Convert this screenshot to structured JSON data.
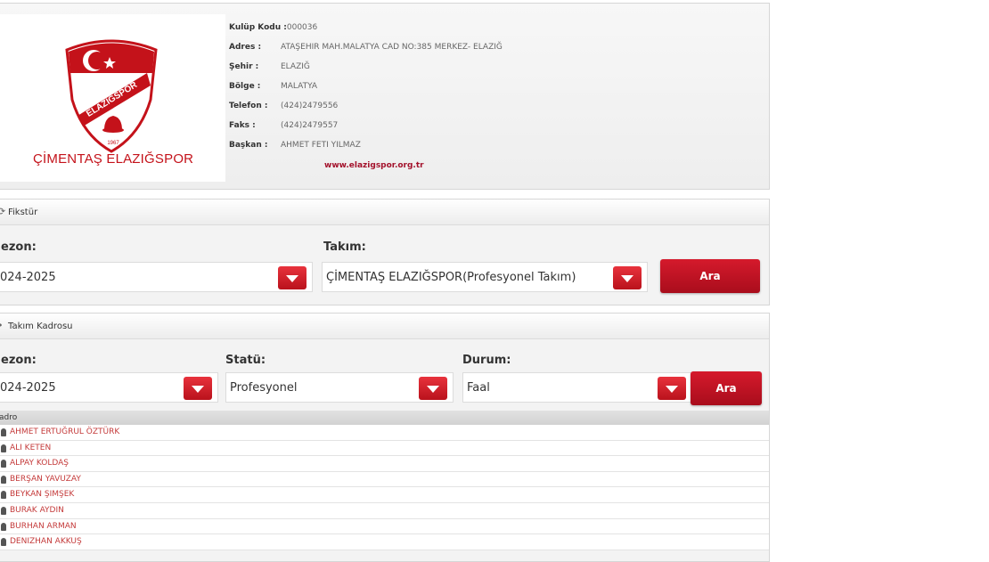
{
  "club": {
    "logo_text": "ELAZIĞSPOR",
    "logo_year": "1967",
    "name": "ÇİMENTAŞ ELAZIĞSPOR",
    "code_label": "Kulüp Kodu :",
    "code_value": "000036",
    "fields": [
      {
        "label": "Adres :",
        "value": "ATAŞEHIR MAH.MALATYA CAD NO:385 MERKEZ- ELAZIĞ"
      },
      {
        "label": "Şehir :",
        "value": "ELAZIĞ"
      },
      {
        "label": "Bölge :",
        "value": "MALATYA"
      },
      {
        "label": "Telefon :",
        "value": "(424)2479556"
      },
      {
        "label": "Faks :",
        "value": "(424)2479557"
      },
      {
        "label": "Başkan :",
        "value": "AHMET FETI YILMAZ"
      }
    ],
    "website": "www.elazigspor.org.tr"
  },
  "fikstur": {
    "title": "Fikstür",
    "sezon_label": "ezon:",
    "sezon_value": "024-2025",
    "takim_label": "Takım:",
    "takim_value": "ÇİMENTAŞ ELAZIĞSPOR(Profesyonel Takım)",
    "button": "Ara"
  },
  "kadro": {
    "title": "Takım Kadrosu",
    "sezon_label": "ezon:",
    "sezon_value": "024-2025",
    "statu_label": "Statü:",
    "statu_value": "Profesyonel",
    "durum_label": "Durum:",
    "durum_value": "Faal",
    "button": "Ara",
    "table_header": "adro",
    "players": [
      "AHMET ERTUĞRUL ÖZTÜRK",
      "ALI KETEN",
      "ALPAY KOLDAŞ",
      "BERŞAN YAVUZAY",
      "BEYKAN ŞIMŞEK",
      "BURAK AYDIN",
      "BURHAN ARMAN",
      "DENIZHAN AKKUŞ"
    ]
  },
  "colors": {
    "accent": "#c4121a",
    "link": "#c43a3a"
  }
}
